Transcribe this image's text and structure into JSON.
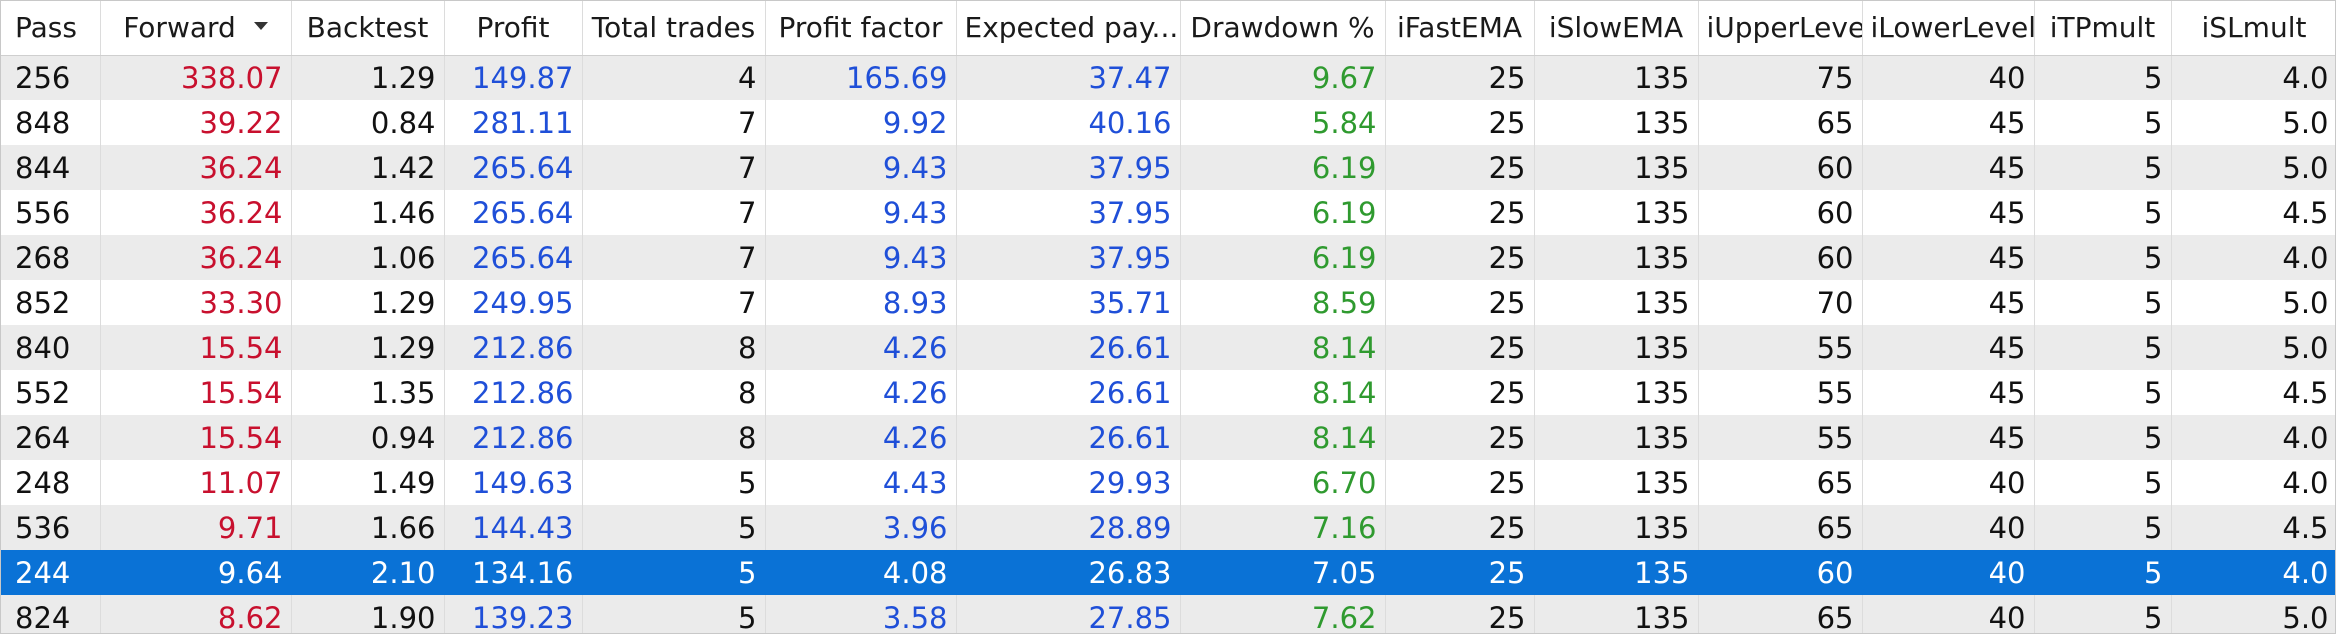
{
  "colors": {
    "forward": "#c8102e",
    "blue_values": "#1f4fd8",
    "drawdown": "#2f9a2f",
    "selection": "#0a72d6",
    "stripe": "#ebebeb"
  },
  "icons": {
    "sort": "sort-descending-icon"
  },
  "columns": [
    "Pass",
    "Forward",
    "Backtest",
    "Profit",
    "Total trades",
    "Profit factor",
    "Expected pay...",
    "Drawdown %",
    "iFastEMA",
    "iSlowEMA",
    "iUpperLevel",
    "iLowerLevel",
    "iTPmult",
    "iSLmult"
  ],
  "sorted_column": "Forward",
  "selected_pass": "244",
  "rows": [
    [
      "256",
      "338.07",
      "1.29",
      "149.87",
      "4",
      "165.69",
      "37.47",
      "9.67",
      "25",
      "135",
      "75",
      "40",
      "5",
      "4.0"
    ],
    [
      "848",
      "39.22",
      "0.84",
      "281.11",
      "7",
      "9.92",
      "40.16",
      "5.84",
      "25",
      "135",
      "65",
      "45",
      "5",
      "5.0"
    ],
    [
      "844",
      "36.24",
      "1.42",
      "265.64",
      "7",
      "9.43",
      "37.95",
      "6.19",
      "25",
      "135",
      "60",
      "45",
      "5",
      "5.0"
    ],
    [
      "556",
      "36.24",
      "1.46",
      "265.64",
      "7",
      "9.43",
      "37.95",
      "6.19",
      "25",
      "135",
      "60",
      "45",
      "5",
      "4.5"
    ],
    [
      "268",
      "36.24",
      "1.06",
      "265.64",
      "7",
      "9.43",
      "37.95",
      "6.19",
      "25",
      "135",
      "60",
      "45",
      "5",
      "4.0"
    ],
    [
      "852",
      "33.30",
      "1.29",
      "249.95",
      "7",
      "8.93",
      "35.71",
      "8.59",
      "25",
      "135",
      "70",
      "45",
      "5",
      "5.0"
    ],
    [
      "840",
      "15.54",
      "1.29",
      "212.86",
      "8",
      "4.26",
      "26.61",
      "8.14",
      "25",
      "135",
      "55",
      "45",
      "5",
      "5.0"
    ],
    [
      "552",
      "15.54",
      "1.35",
      "212.86",
      "8",
      "4.26",
      "26.61",
      "8.14",
      "25",
      "135",
      "55",
      "45",
      "5",
      "4.5"
    ],
    [
      "264",
      "15.54",
      "0.94",
      "212.86",
      "8",
      "4.26",
      "26.61",
      "8.14",
      "25",
      "135",
      "55",
      "45",
      "5",
      "4.0"
    ],
    [
      "248",
      "11.07",
      "1.49",
      "149.63",
      "5",
      "4.43",
      "29.93",
      "6.70",
      "25",
      "135",
      "65",
      "40",
      "5",
      "4.0"
    ],
    [
      "536",
      "9.71",
      "1.66",
      "144.43",
      "5",
      "3.96",
      "28.89",
      "7.16",
      "25",
      "135",
      "65",
      "40",
      "5",
      "4.5"
    ],
    [
      "244",
      "9.64",
      "2.10",
      "134.16",
      "5",
      "4.08",
      "26.83",
      "7.05",
      "25",
      "135",
      "60",
      "40",
      "5",
      "4.0"
    ],
    [
      "824",
      "8.62",
      "1.90",
      "139.23",
      "5",
      "3.58",
      "27.85",
      "7.62",
      "25",
      "135",
      "65",
      "40",
      "5",
      "5.0"
    ]
  ]
}
